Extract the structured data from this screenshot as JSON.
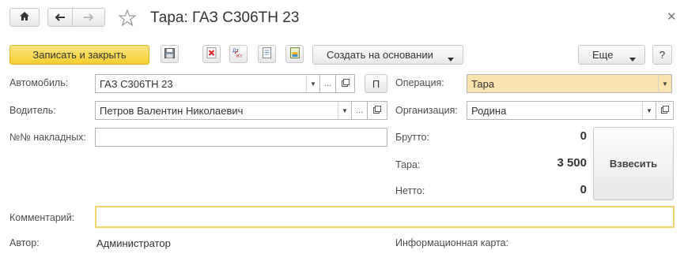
{
  "header": {
    "title": "Тара: ГАЗ С306ТН 23",
    "home_icon": "home-icon",
    "back_icon": "arrow-left-icon",
    "forward_icon": "arrow-right-icon",
    "favorite_icon": "star-icon",
    "close_icon": "close-icon"
  },
  "toolbar": {
    "save_close_label": "Записать и закрыть",
    "create_based_label": "Создать на основании",
    "more_label": "Еще",
    "help_label": "?",
    "icons": [
      "save-icon",
      "delete-icon",
      "register-movements-icon",
      "document-icon",
      "report-icon"
    ]
  },
  "form": {
    "car_label": "Автомобиль:",
    "car_value": "ГАЗ С306ТН 23",
    "car_p_label": "П",
    "driver_label": "Водитель:",
    "driver_value": "Петров Валентин Николаевич",
    "invoices_label": "№№ накладных:",
    "invoices_value": "",
    "operation_label": "Операция:",
    "operation_value": "Тара",
    "org_label": "Организация:",
    "org_value": "Родина",
    "gross_label": "Брутто:",
    "gross_value": "0",
    "tare_label": "Тара:",
    "tare_value": "3 500",
    "net_label": "Нетто:",
    "net_value": "0",
    "weigh_label": "Взвесить",
    "comment_label": "Комментарий:",
    "comment_value": "",
    "author_label": "Автор:",
    "author_value": "Администратор",
    "infocard_label": "Информационная карта:"
  },
  "colors": {
    "accent_yellow": "#f5cf2e",
    "field_yellow": "#fbe3b0",
    "comment_border": "#f3d36b"
  }
}
